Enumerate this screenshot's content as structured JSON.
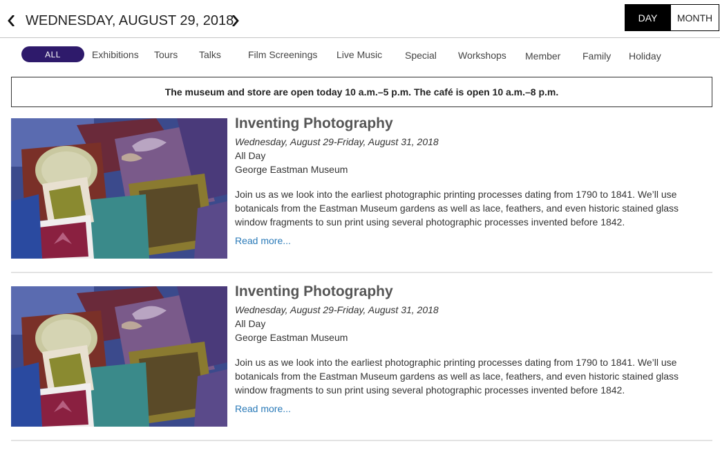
{
  "header": {
    "date_title": "WEDNESDAY, AUGUST 29, 2018",
    "view_day": "DAY",
    "view_month": "MONTH"
  },
  "filters": {
    "all": "ALL",
    "items": [
      "Exhibitions",
      "Tours",
      "Talks",
      "Film Screenings",
      "Live Music",
      "Special",
      "Workshops",
      "Member",
      "Family",
      "Holiday"
    ]
  },
  "notice": "The museum and store are open today 10 a.m.–5 p.m. The café is open 10 a.m.–8 p.m.",
  "events": [
    {
      "title": "Inventing Photography",
      "dates": "Wednesday, August 29-Friday, August 31, 2018",
      "time": "All Day",
      "location": "George Eastman Museum",
      "description": "Join us as we look into the earliest photographic printing processes dating from 1790 to 1841. We’ll use botanicals from the Eastman Museum gardens as well as lace, feathers, and even historic stained glass window fragments to sun print using several photographic processes invented before 1842.",
      "read_more": "Read more..."
    },
    {
      "title": "Inventing Photography",
      "dates": "Wednesday, August 29-Friday, August 31, 2018",
      "time": "All Day",
      "location": "George Eastman Museum",
      "description": "Join us as we look into the earliest photographic printing processes dating from 1790 to 1841. We’ll use botanicals from the Eastman Museum gardens as well as lace, feathers, and even historic stained glass window fragments to sun print using several photographic processes invented before 1842.",
      "read_more": "Read more..."
    }
  ],
  "colors": {
    "accent": "#2e1a6b",
    "link": "#2a7ab8",
    "active_view": "#000000"
  },
  "icons": {
    "prev": "chevron-left-icon",
    "next": "chevron-right-icon"
  }
}
